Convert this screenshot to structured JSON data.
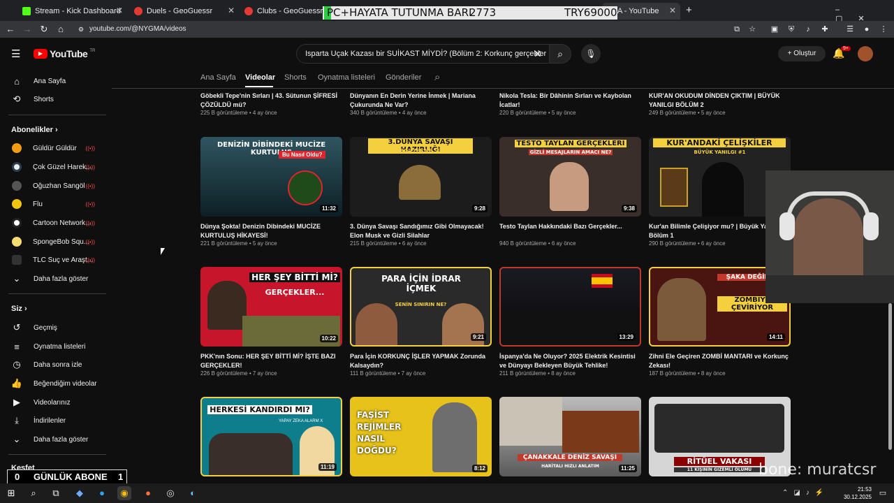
{
  "browser": {
    "tabs": [
      {
        "title": "Stream - Kick Dashboard",
        "color": "#53fc18"
      },
      {
        "title": "Duels - GeoGuessr",
        "color": "#e53935"
      },
      {
        "title": "Clubs - GeoGuessr",
        "color": "#e53935"
      },
      {
        "title": "A - YouTube",
        "color": "#ff0000"
      }
    ],
    "new_tab": "+",
    "url": "youtube.com/@NYGMA/videos"
  },
  "overlay": {
    "left": "PC+HAYATA TUTUNMA BARI",
    "mid": "2773",
    "right": "TRY69000"
  },
  "youtube": {
    "logo": "YouTube",
    "region": "TR",
    "search_value": "Isparta Uçak Kazası bir SUİKAST MİYDİ? (Bölüm 2: Korkunç gerçekler",
    "create_label": "Oluştur",
    "notif_badge": "9+",
    "sidebar": {
      "top": [
        {
          "label": "Ana Sayfa",
          "icon": "home-icon"
        },
        {
          "label": "Shorts",
          "icon": "shorts-icon"
        }
      ],
      "subs_header": "Abonelikler",
      "subs": [
        {
          "label": "Güldür Güldür",
          "color": "#f39c12"
        },
        {
          "label": "Çok Güzel Harek...",
          "color": "#2c3e50"
        },
        {
          "label": "Oğuzhan Sangöl",
          "color": "#555555"
        },
        {
          "label": "Flu",
          "color": "#f1c40f"
        },
        {
          "label": "Cartoon Network...",
          "color": "#222222"
        },
        {
          "label": "SpongeBob Squ...",
          "color": "#f7dc6f"
        },
        {
          "label": "TLC Suç ve Araşt...",
          "color": "#333333"
        }
      ],
      "show_more": "Daha fazla göster",
      "you_header": "Siz",
      "you": [
        {
          "label": "Geçmiş",
          "icon": "history-icon"
        },
        {
          "label": "Oynatma listeleri",
          "icon": "playlist-icon"
        },
        {
          "label": "Daha sonra izle",
          "icon": "clock-icon"
        },
        {
          "label": "Beğendiğim videolar",
          "icon": "like-icon"
        },
        {
          "label": "Videolarınız",
          "icon": "video-icon"
        },
        {
          "label": "İndirilenler",
          "icon": "download-icon"
        }
      ],
      "show_more2": "Daha fazla göster",
      "explore": "Keşfet"
    },
    "channel_tabs": [
      "Ana Sayfa",
      "Videolar",
      "Shorts",
      "Oynatma listeleri",
      "Gönderiler"
    ],
    "active_tab": "Videolar",
    "videos_row0": [
      {
        "title": "Göbekli Tepe'nin Sırları | 43. Sütunun ŞİFRESİ ÇÖZÜLDÜ mü?",
        "meta": "225 B görüntüleme • 4 ay önce"
      },
      {
        "title": "Dünyanın En Derin Yerine İnmek | Mariana Çukurunda Ne Var?",
        "meta": "340 B görüntüleme • 4 ay önce"
      },
      {
        "title": "Nikola Tesla: Bir Dâhinin Sırları ve Kaybolan İcatlar!",
        "meta": "220 B görüntüleme • 5 ay önce"
      },
      {
        "title": "KUR'AN OKUDUM DİNDEN ÇIKTIM | BÜYÜK YANILGI BÖLÜM 2",
        "meta": "249 B görüntüleme • 5 ay önce"
      }
    ],
    "videos_row1": [
      {
        "title": "Dünya Şokta! Denizin Dibindeki MUCİZE KURTULUŞ HİKAYESİ!",
        "meta": "221 B görüntüleme • 5 ay önce",
        "duration": "11:32",
        "thumb_title": "DENİZİN DİBİNDEKİ MUCİZE KURTULUŞ",
        "thumb_sub": "Bu Nasıl Oldu?",
        "bg": "#1e3a44"
      },
      {
        "title": "3. Dünya Savaşı Sandığımız Gibi Olmayacak! Elon Musk ve Gizli Silahlar",
        "meta": "215 B görüntüleme • 6 ay önce",
        "duration": "9:28",
        "thumb_title": "3.DÜNYA SAVAŞI HAZIRLIĞI",
        "thumb_sub": "GİZLİ PROJELER VE SİLAHLAR",
        "bg": "#2b2b2b"
      },
      {
        "title": "Testo Taylan Hakkındaki Bazı Gerçekler...",
        "meta": "940 B görüntüleme • 6 ay önce",
        "duration": "9:38",
        "thumb_title": "TESTO TAYLAN GERÇEKLERİ",
        "thumb_sub": "GİZLİ MESAJLARIN AMACI NE?",
        "bg": "#3a2e2a"
      },
      {
        "title": "Kur'an Bilimle Çelişiyor mu? | Büyük Yanılgı Bölüm 1",
        "meta": "290 B görüntüleme • 6 ay önce",
        "duration": "",
        "thumb_title": "KUR'ANDAKİ ÇELİŞKİLER",
        "thumb_sub": "BÜYÜK YANILGI #1",
        "bg": "#222222"
      }
    ],
    "videos_row2": [
      {
        "title": "PKK'nın Sonu: HER ŞEY BİTTİ Mİ? İŞTE BAZI GERÇEKLER!",
        "meta": "226 B görüntüleme • 7 ay önce",
        "duration": "10:22",
        "thumb_title": "HER ŞEY BİTTİ Mİ?",
        "thumb_sub": "GERÇEKLER...",
        "bg": "#c7162b"
      },
      {
        "title": "Para İçin KORKUNÇ İŞLER YAPMAK Zorunda Kalsaydın?",
        "meta": "111 B görüntüleme • 7 ay önce",
        "duration": "9:21",
        "thumb_title": "PARA İÇİN İDRAR İÇMEK",
        "thumb_sub": "SENİN SINIRIN NE?",
        "bg": "#2a2a2a"
      },
      {
        "title": "İspanya'da Ne Oluyor? 2025 Elektrik Kesintisi ve Dünyayı Bekleyen Büyük Tehlike!",
        "meta": "211 B görüntüleme • 8 ay önce",
        "duration": "13:29",
        "thumb_title": "",
        "thumb_sub": "",
        "bg": "#15151a"
      },
      {
        "title": "Zihni Ele Geçiren ZOMBİ MANTARI ve Korkunç Zekası!",
        "meta": "187 B görüntüleme • 8 ay önce",
        "duration": "14:11",
        "thumb_title": "ŞAKA DEĞİL!",
        "thumb_sub": "ZOMBİYE ÇEVİRİYOR",
        "bg": "#4a1510"
      }
    ],
    "videos_row3": [
      {
        "duration": "11:19",
        "thumb_title": "HERKESİ KANDIRDI MI?",
        "thumb_sub": "YAPAY ZEKA ALARM X",
        "bg": "#0e7d8c"
      },
      {
        "duration": "8:12",
        "thumb_title": "FAŞİST REJİMLER NASIL DOĞDU?",
        "thumb_sub": "",
        "bg": "#e6c21a"
      },
      {
        "duration": "11:25",
        "thumb_title": "ÇANAKKALE DENİZ SAVAŞI",
        "thumb_sub": "HARİTALI HIZLI ANLATIM",
        "bg": "#6b6b6b"
      },
      {
        "duration": "",
        "thumb_title": "RİTÜEL VAKASI",
        "thumb_sub": "11 KİŞİNİN GİZEMLİ ÖLÜMÜ",
        "bg": "#d6d6d6"
      }
    ]
  },
  "stream": {
    "abone_left": "0",
    "abone_label": "GÜNLÜK ABONE",
    "abone_right": "1",
    "kick_name": "bone: muratcsr"
  },
  "taskbar": {
    "time": "21:53",
    "date": "30.12.2025"
  }
}
